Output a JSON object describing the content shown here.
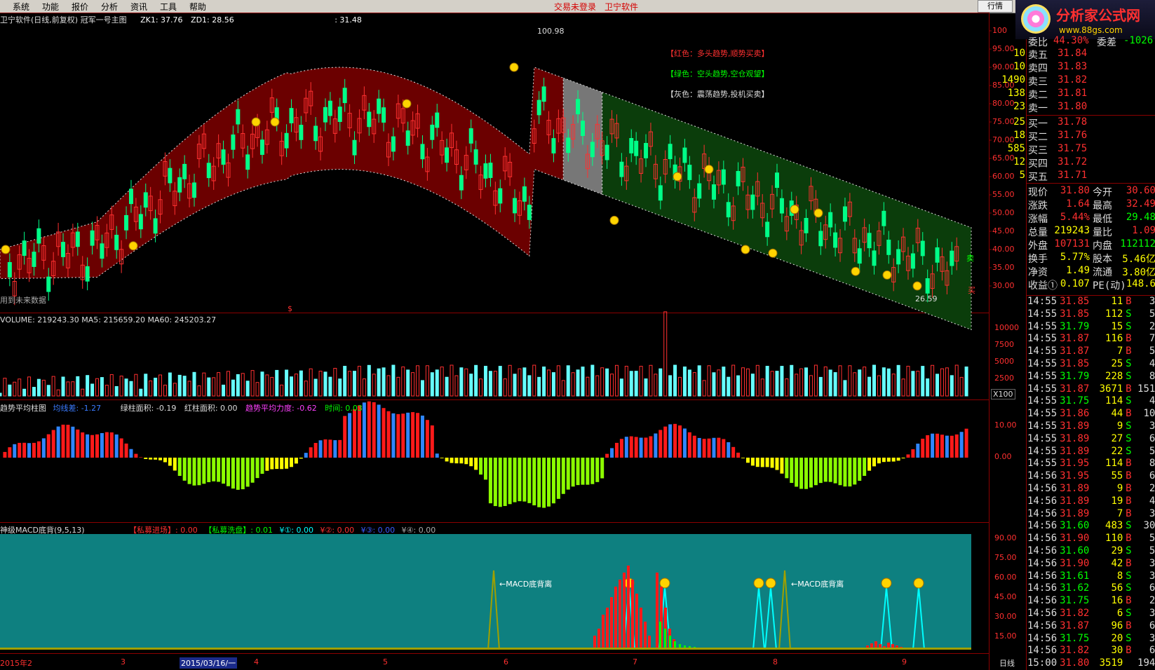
{
  "menu": {
    "items": [
      "系统",
      "功能",
      "报价",
      "分析",
      "资讯",
      "工具",
      "帮助"
    ],
    "status_login": "交易未登录",
    "status_vendor": "卫宁软件",
    "quote_button": "行情"
  },
  "logo": {
    "title": "分析家公式网",
    "url": "www.88gs.com"
  },
  "main_panel": {
    "title": "卫宁软件(日线,前复权) 冠军一号主图",
    "zk1": "ZK1: 37.76",
    "zd1": "ZD1: 28.56",
    "extra": ": 31.48",
    "legend_red": "【红色：多头趋势,顺势买卖】",
    "legend_green": "【绿色：空头趋势,空仓观望】",
    "legend_gray": "【灰色：震荡趋势,投机买卖】",
    "high_label": "100.98",
    "low_label": "26.59",
    "future_note": "用到未来数据",
    "sell_tag": "卖",
    "buy_tag": "买",
    "dollar_tag": "$",
    "y_ticks": [
      "100",
      "95.00",
      "90.00",
      "85.00",
      "80.00",
      "75.00",
      "70.00",
      "65.00",
      "60.00",
      "55.00",
      "50.00",
      "45.00",
      "40.00",
      "35.00",
      "30.00"
    ]
  },
  "volume_panel": {
    "header": "VOLUME: 219243.30  MA5: 215659.20  MA60: 245203.27",
    "y_ticks": [
      "10000",
      "7500",
      "5000",
      "2500"
    ],
    "unit": "X100"
  },
  "trend_panel": {
    "header_1": "趋势平均柱图",
    "header_1b": "均线差: -1.27",
    "header_2": "绿柱面积: -0.19",
    "header_3": "红柱面积: 0.00",
    "header_4": "趋势平均力度: -0.62",
    "header_5": "时间: 0.03",
    "y_ticks": [
      "10.00",
      "0.00"
    ]
  },
  "macd_panel": {
    "header_1": "神级MACD底背(9,5,13)",
    "header_2": "【私募进场】: 0.00",
    "header_3": "【私募洗盘】: 0.01",
    "header_4": "¥①: 0.00",
    "header_5": "¥②: 0.00",
    "header_6": "¥③: 0.00",
    "header_7": "¥④: 0.00",
    "annot_1": "←MACD底背离",
    "annot_2": "←MACD底背离",
    "y_ticks": [
      "90.00",
      "75.00",
      "60.00",
      "45.00",
      "30.00",
      "15.00"
    ]
  },
  "x_axis": {
    "labels": [
      "2015年2",
      "3",
      "2015/03/16/一",
      "4",
      "5",
      "6",
      "7",
      "8",
      "9"
    ],
    "period": "日线"
  },
  "colors": {
    "up": "#ff2020",
    "down": "#00ffff",
    "bull_band": "#6b0000",
    "bear_band": "#0b3d0b",
    "flat_band": "#777777",
    "teal": "#0e8080"
  },
  "quote": {
    "top_row": {
      "label": "委比",
      "value": "44.30%",
      "label2": "委差",
      "value2": "-1026"
    },
    "asks": [
      {
        "label": "卖五",
        "price": "31.84",
        "vol": "10"
      },
      {
        "label": "卖四",
        "price": "31.83",
        "vol": "10"
      },
      {
        "label": "卖三",
        "price": "31.82",
        "vol": "1490"
      },
      {
        "label": "卖二",
        "price": "31.81",
        "vol": "138"
      },
      {
        "label": "卖一",
        "price": "31.80",
        "vol": "23"
      }
    ],
    "bids": [
      {
        "label": "买一",
        "price": "31.78",
        "vol": "25"
      },
      {
        "label": "买二",
        "price": "31.76",
        "vol": "18"
      },
      {
        "label": "买三",
        "price": "31.75",
        "vol": "585"
      },
      {
        "label": "买四",
        "price": "31.72",
        "vol": "12"
      },
      {
        "label": "买五",
        "price": "31.71",
        "vol": "5"
      }
    ],
    "stats": [
      {
        "l1": "现价",
        "v1": "31.80",
        "l2": "今开",
        "v2": "30.60",
        "c1": "#ff3030",
        "c2": "#ff3030"
      },
      {
        "l1": "涨跌",
        "v1": "1.64",
        "l2": "最高",
        "v2": "32.49",
        "c1": "#ff3030",
        "c2": "#ff3030"
      },
      {
        "l1": "涨幅",
        "v1": "5.44%",
        "l2": "最低",
        "v2": "29.48",
        "c1": "#ff3030",
        "c2": "#00ff00"
      },
      {
        "l1": "总量",
        "v1": "219243",
        "l2": "量比",
        "v2": "1.09",
        "c1": "#ffff00",
        "c2": "#ff3030"
      },
      {
        "l1": "外盘",
        "v1": "107131",
        "l2": "内盘",
        "v2": "112112",
        "c1": "#ff3030",
        "c2": "#00ff00"
      },
      {
        "l1": "换手",
        "v1": "5.77%",
        "l2": "股本",
        "v2": "5.46亿",
        "c1": "#ffff00",
        "c2": "#ffff00"
      },
      {
        "l1": "净资",
        "v1": "1.49",
        "l2": "流通",
        "v2": "3.80亿",
        "c1": "#ffff00",
        "c2": "#ffff00"
      },
      {
        "l1": "收益①",
        "v1": "0.107",
        "l2": "PE(动)",
        "v2": "148.6",
        "c1": "#ffff00",
        "c2": "#ffff00"
      }
    ],
    "ticks": [
      [
        "14:55",
        "31.85",
        "11",
        "B",
        "3"
      ],
      [
        "14:55",
        "31.85",
        "112",
        "S",
        "5"
      ],
      [
        "14:55",
        "31.79",
        "15",
        "S",
        "2"
      ],
      [
        "14:55",
        "31.87",
        "116",
        "B",
        "7"
      ],
      [
        "14:55",
        "31.87",
        "7",
        "B",
        "5"
      ],
      [
        "14:55",
        "31.85",
        "25",
        "S",
        "4"
      ],
      [
        "14:55",
        "31.79",
        "228",
        "S",
        "8"
      ],
      [
        "14:55",
        "31.87",
        "3671",
        "B",
        "151"
      ],
      [
        "14:55",
        "31.75",
        "114",
        "S",
        "4"
      ],
      [
        "14:55",
        "31.86",
        "44",
        "B",
        "10"
      ],
      [
        "14:55",
        "31.89",
        "9",
        "S",
        "3"
      ],
      [
        "14:55",
        "31.89",
        "27",
        "S",
        "6"
      ],
      [
        "14:55",
        "31.89",
        "22",
        "S",
        "5"
      ],
      [
        "14:55",
        "31.95",
        "114",
        "B",
        "8"
      ],
      [
        "14:56",
        "31.95",
        "55",
        "B",
        "6"
      ],
      [
        "14:56",
        "31.89",
        "9",
        "B",
        "2"
      ],
      [
        "14:56",
        "31.89",
        "19",
        "B",
        "4"
      ],
      [
        "14:56",
        "31.89",
        "7",
        "B",
        "3"
      ],
      [
        "14:56",
        "31.60",
        "483",
        "S",
        "30"
      ],
      [
        "14:56",
        "31.90",
        "110",
        "B",
        "5"
      ],
      [
        "14:56",
        "31.60",
        "29",
        "S",
        "5"
      ],
      [
        "14:56",
        "31.90",
        "42",
        "B",
        "3"
      ],
      [
        "14:56",
        "31.61",
        "8",
        "S",
        "3"
      ],
      [
        "14:56",
        "31.62",
        "56",
        "S",
        "6"
      ],
      [
        "14:56",
        "31.75",
        "16",
        "B",
        "2"
      ],
      [
        "14:56",
        "31.82",
        "6",
        "S",
        "3"
      ],
      [
        "14:56",
        "31.87",
        "96",
        "B",
        "6"
      ],
      [
        "14:56",
        "31.75",
        "20",
        "S",
        "3"
      ],
      [
        "14:56",
        "31.82",
        "30",
        "B",
        "6"
      ],
      [
        "15:00",
        "31.80",
        "3519",
        "",
        "194"
      ]
    ]
  }
}
